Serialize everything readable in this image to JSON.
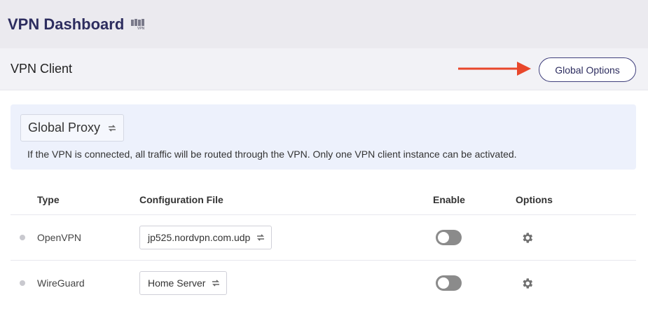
{
  "header": {
    "title": "VPN Dashboard",
    "logo_icon": "vpn-logo-icon"
  },
  "subheader": {
    "title": "VPN Client",
    "global_options_label": "Global Options",
    "arrow_color": "#e8472b"
  },
  "proxy": {
    "selected": "Global Proxy",
    "note": "If the VPN is connected, all traffic will be routed through the VPN. Only one VPN client instance can be activated."
  },
  "table": {
    "headers": {
      "type": "Type",
      "config": "Configuration File",
      "enable": "Enable",
      "options": "Options"
    },
    "rows": [
      {
        "type": "OpenVPN",
        "config": "jp525.nordvpn.com.udp",
        "enabled": false
      },
      {
        "type": "WireGuard",
        "config": "Home Server",
        "enabled": false
      }
    ]
  },
  "colors": {
    "accent": "#2d2d5f",
    "panel_bg": "#edf1fc",
    "toggle_off": "#8b8b8b"
  }
}
